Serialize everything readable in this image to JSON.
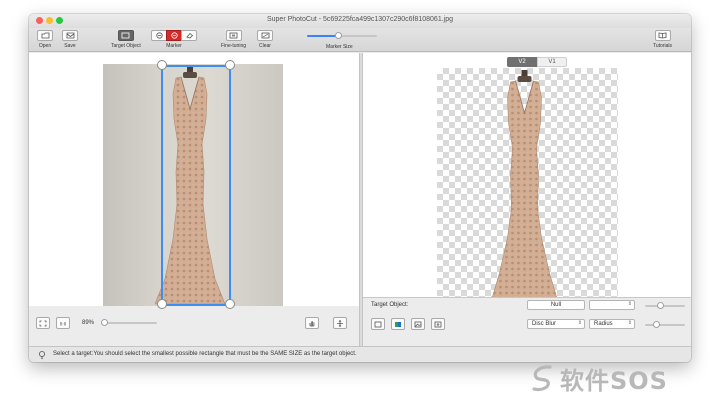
{
  "window": {
    "title": "Super PhotoCut - 5c69225fca499c1307c290c6f8108061.jpg"
  },
  "toolbar": {
    "open_label": "Open",
    "save_label": "Save",
    "target_object_label": "Target Object",
    "marker_label": "Marker",
    "fine_tuning_label": "Fine-tuning",
    "clear_label": "Clear",
    "marker_size_label": "Marker Size",
    "marker_size_value": 0.45,
    "tutorials_label": "Tutorials"
  },
  "view_toggle": {
    "v2_label": "V2",
    "v1_label": "V1"
  },
  "left_bottom": {
    "zoom_text": "89%",
    "zoom_value": 0.05
  },
  "right_bottom": {
    "target_object_label": "Target Object:",
    "target_object_value": "Null",
    "mode_value": "",
    "disc_blur_label": "Disc Blur",
    "radius_label": "Radius"
  },
  "status": {
    "text": "Select a target:You should select the smallest possible rectangle that must be the SAME SIZE as the target object."
  },
  "watermark": {
    "text": "软件SOS"
  }
}
